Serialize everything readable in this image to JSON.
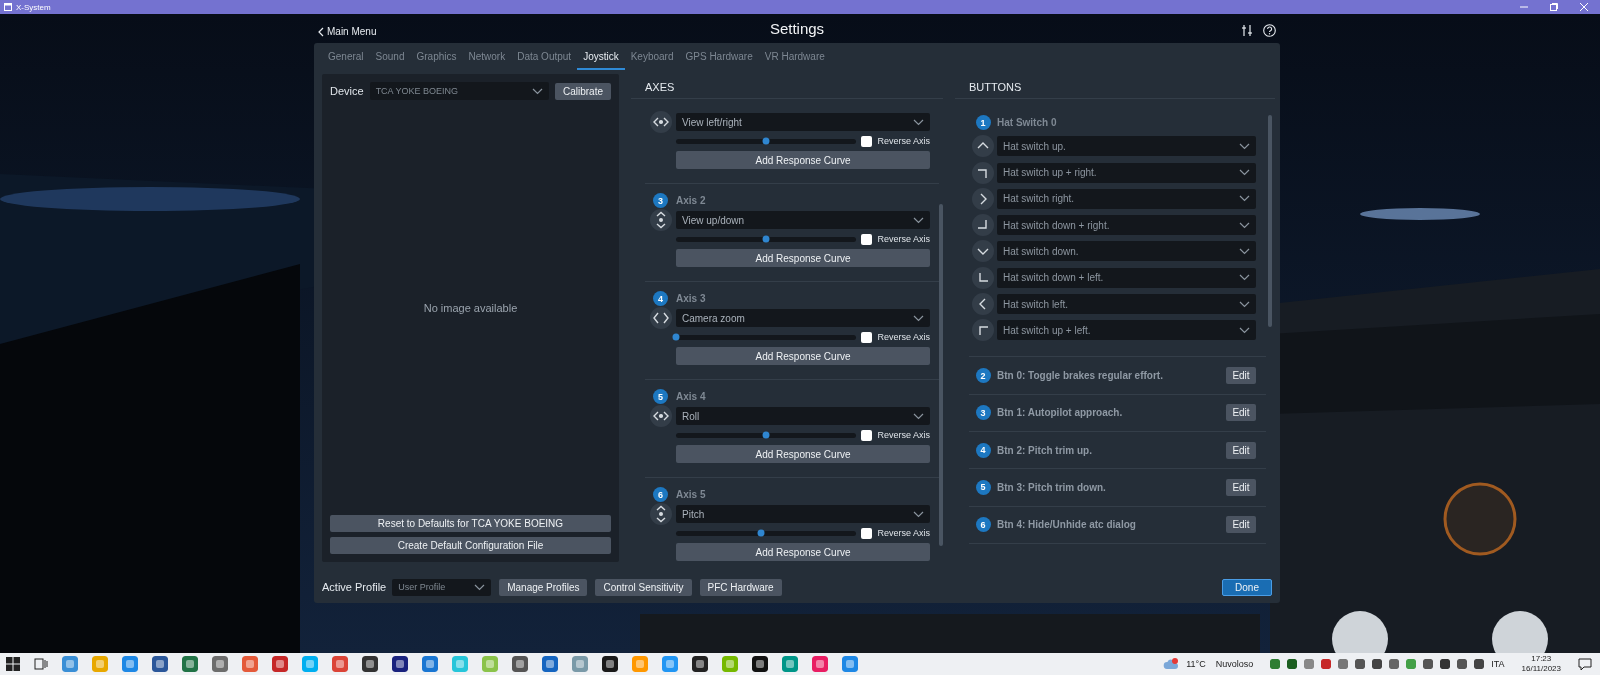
{
  "title_bar": {
    "title": "X-System"
  },
  "header": {
    "back": "Main Menu",
    "title": "Settings"
  },
  "tabs": [
    {
      "label": "General",
      "selected": false
    },
    {
      "label": "Sound",
      "selected": false
    },
    {
      "label": "Graphics",
      "selected": false
    },
    {
      "label": "Network",
      "selected": false
    },
    {
      "label": "Data Output",
      "selected": false
    },
    {
      "label": "Joystick",
      "selected": true
    },
    {
      "label": "Keyboard",
      "selected": false
    },
    {
      "label": "GPS Hardware",
      "selected": false
    },
    {
      "label": "VR Hardware",
      "selected": false
    }
  ],
  "device": {
    "label": "Device",
    "value": "TCA YOKE BOEING",
    "calibrate": "Calibrate",
    "image_placeholder": "No image available",
    "buttons": [
      "Reset to Defaults for TCA YOKE BOEING",
      "Create Default Configuration File"
    ]
  },
  "axes": {
    "title": "AXES",
    "items": [
      {
        "kind": "horizontal",
        "action": "View left/right",
        "level": 0.5,
        "reverse": {
          "label": "Reverse Axis",
          "checked": false
        },
        "curve_button": "Add Response Curve"
      },
      {
        "number": "3",
        "label": "Axis 2",
        "kind": "vertical",
        "action": "View up/down",
        "level": 0.5,
        "reverse": {
          "label": "Reverse Axis",
          "checked": false
        },
        "curve_button": "Add Response Curve"
      },
      {
        "number": "4",
        "label": "Axis 3",
        "kind": "zoom",
        "action": "Camera zoom",
        "level": 0.0,
        "reverse": {
          "label": "Reverse Axis",
          "checked": false
        },
        "curve_button": "Add Response Curve"
      },
      {
        "number": "5",
        "label": "Axis 4",
        "kind": "horizontal",
        "action": "Roll",
        "level": 0.5,
        "reverse": {
          "label": "Reverse Axis",
          "checked": false
        },
        "curve_button": "Add Response Curve"
      },
      {
        "number": "6",
        "label": "Axis 5",
        "kind": "vertical",
        "action": "Pitch",
        "level": 0.47,
        "reverse": {
          "label": "Reverse Axis",
          "checked": false
        },
        "curve_button": "Add Response Curve"
      }
    ]
  },
  "buttons": {
    "title": "BUTTONS",
    "hat": {
      "number": "1",
      "label": "Hat Switch 0",
      "rows": [
        {
          "kind": "up",
          "action": "Hat switch up."
        },
        {
          "kind": "up-right",
          "action": "Hat switch up + right."
        },
        {
          "kind": "right",
          "action": "Hat switch right."
        },
        {
          "kind": "down-right",
          "action": "Hat switch down + right."
        },
        {
          "kind": "down",
          "action": "Hat switch down."
        },
        {
          "kind": "down-left",
          "action": "Hat switch down + left."
        },
        {
          "kind": "left",
          "action": "Hat switch left."
        },
        {
          "kind": "up-left",
          "action": "Hat switch up + left."
        }
      ]
    },
    "items": [
      {
        "number": "2",
        "label": "Btn 0: Toggle brakes regular effort.",
        "edit": "Edit"
      },
      {
        "number": "3",
        "label": "Btn 1: Autopilot approach.",
        "edit": "Edit"
      },
      {
        "number": "4",
        "label": "Btn 2: Pitch trim up.",
        "edit": "Edit"
      },
      {
        "number": "5",
        "label": "Btn 3: Pitch trim down.",
        "edit": "Edit"
      },
      {
        "number": "6",
        "label": "Btn 4: Hide/Unhide atc dialog",
        "edit": "Edit"
      }
    ]
  },
  "footer": {
    "profile_label": "Active Profile",
    "profile": "User Profile",
    "buttons": [
      "Manage Profiles",
      "Control Sensitivity",
      "PFC Hardware"
    ],
    "done": "Done"
  },
  "taskbar": {
    "temperature": "11°C",
    "weather": "Nuvoloso",
    "language": "ITA",
    "time": "17:23",
    "date": "16/11/2023"
  }
}
